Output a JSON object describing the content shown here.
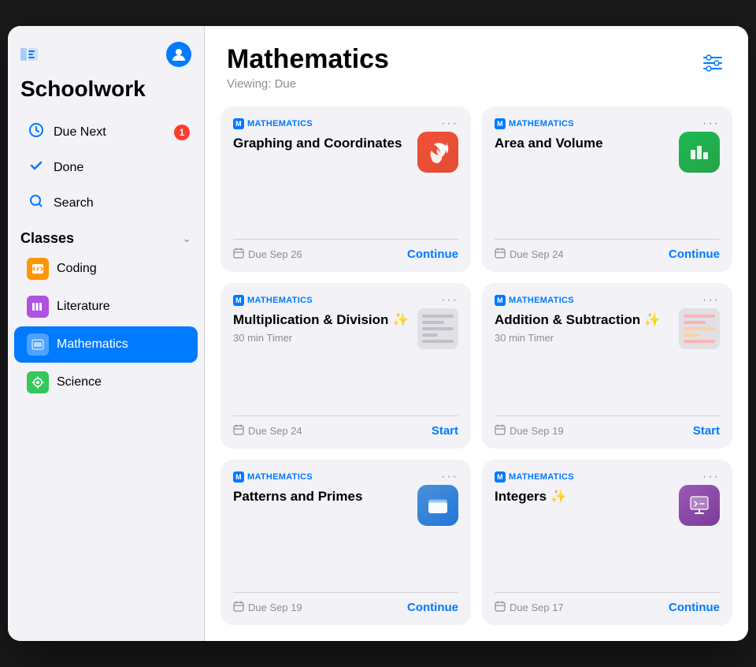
{
  "sidebar": {
    "title": "Schoolwork",
    "nav": {
      "due_next_label": "Due Next",
      "done_label": "Done",
      "search_label": "Search",
      "due_next_badge": "1"
    },
    "classes_section_label": "Classes",
    "classes": [
      {
        "id": "coding",
        "label": "Coding",
        "icon": "📋",
        "color": "orange",
        "active": false
      },
      {
        "id": "literature",
        "label": "Literature",
        "icon": "📊",
        "color": "purple",
        "active": false
      },
      {
        "id": "mathematics",
        "label": "Mathematics",
        "icon": "📋",
        "color": "blue",
        "active": true
      },
      {
        "id": "science",
        "label": "Science",
        "icon": "🧬",
        "color": "green",
        "active": false
      }
    ]
  },
  "main": {
    "page_title": "Mathematics",
    "viewing_label": "Viewing: Due",
    "filter_icon": "≡",
    "assignments": [
      {
        "id": "graphing",
        "subject": "MATHEMATICS",
        "title": "Graphing and Coordinates",
        "subtitle": "",
        "app_type": "swift",
        "due_date": "Due Sep 26",
        "action": "Continue"
      },
      {
        "id": "area-volume",
        "subject": "MATHEMATICS",
        "title": "Area and Volume",
        "subtitle": "",
        "app_type": "numbers",
        "due_date": "Due Sep 24",
        "action": "Continue"
      },
      {
        "id": "multiplication",
        "subject": "MATHEMATICS",
        "title": "Multiplication & Division ✨",
        "subtitle": "30 min Timer",
        "app_type": "thumbnail",
        "due_date": "Due Sep 24",
        "action": "Start"
      },
      {
        "id": "addition",
        "subject": "MATHEMATICS",
        "title": "Addition & Subtraction ✨",
        "subtitle": "30 min Timer",
        "app_type": "thumbnail2",
        "due_date": "Due Sep 19",
        "action": "Start"
      },
      {
        "id": "patterns",
        "subject": "MATHEMATICS",
        "title": "Patterns and Primes",
        "subtitle": "",
        "app_type": "files",
        "due_date": "Due Sep 19",
        "action": "Continue"
      },
      {
        "id": "integers",
        "subject": "MATHEMATICS",
        "title": "Integers ✨",
        "subtitle": "",
        "app_type": "keynote",
        "due_date": "Due Sep 17",
        "action": "Continue"
      }
    ]
  }
}
